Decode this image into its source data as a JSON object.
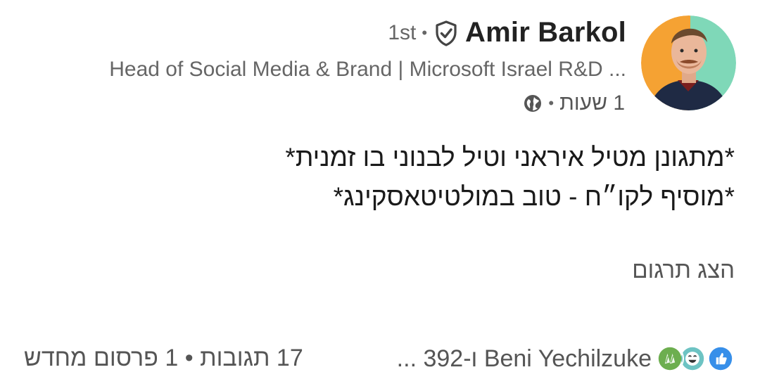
{
  "author": {
    "name": "Amir Barkol",
    "degree": "1st",
    "separator": "•",
    "headline": "Head of Social Media & Brand | Microsoft Israel R&D ...",
    "time": "1 שעות",
    "avatar_icon": "avatar-photo",
    "verified_icon": "verified-shield-icon",
    "visibility_icon": "globe-icon"
  },
  "post": {
    "lines": [
      "*מתגונן מטיל איראני וטיל לבנוני בו זמנית*",
      "*מוסיף לקו״ח - טוב במולטיטאסקינג*"
    ],
    "translate_label": "הצג תרגום"
  },
  "footer": {
    "reaction_summary": "Beni Yechilzuke ו-392 ...",
    "counts": "17 תגובות • 1 פרסום מחדש",
    "reaction_icons": [
      "like-icon",
      "funny-icon",
      "celebrate-icon"
    ]
  },
  "colors": {
    "like": "#378fe9",
    "funny": "#6dc3c3",
    "celebrate": "#6dae4f",
    "avatar_bg_left": "#f5a233",
    "avatar_bg_right": "#7fd8b8"
  }
}
